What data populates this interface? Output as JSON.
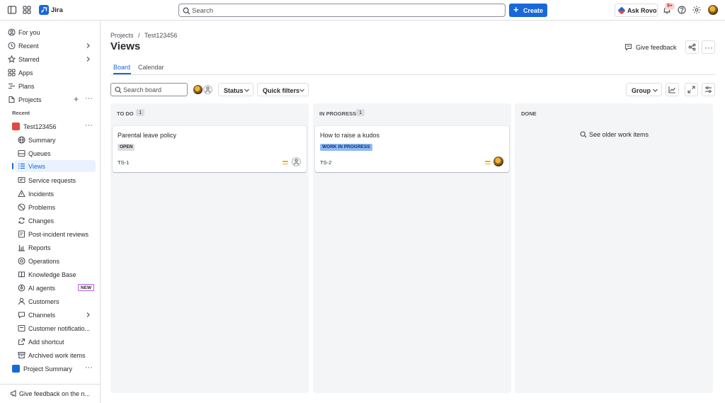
{
  "topbar": {
    "app_name": "Jira",
    "search_placeholder": "Search",
    "create_label": "Create",
    "ask_rovo_label": "Ask Rovo",
    "notifications_badge": "9+"
  },
  "sidebar": {
    "top_items": [
      {
        "label": "For you",
        "icon": "person-circle-icon"
      },
      {
        "label": "Recent",
        "icon": "clock-icon"
      },
      {
        "label": "Starred",
        "icon": "star-icon"
      },
      {
        "label": "Apps",
        "icon": "apps-grid-icon"
      },
      {
        "label": "Plans",
        "icon": "plans-icon"
      },
      {
        "label": "Projects",
        "icon": "projects-icon"
      }
    ],
    "recent_header": "Recent",
    "project": {
      "name": "Test123456",
      "icon_color": "#E2483D"
    },
    "project_items": [
      {
        "label": "Summary",
        "icon": "globe-icon"
      },
      {
        "label": "Queues",
        "icon": "queues-icon"
      },
      {
        "label": "Views",
        "icon": "list-icon"
      },
      {
        "label": "Service requests",
        "icon": "service-request-icon"
      },
      {
        "label": "Incidents",
        "icon": "warning-icon"
      },
      {
        "label": "Problems",
        "icon": "problem-icon"
      },
      {
        "label": "Changes",
        "icon": "changes-icon"
      },
      {
        "label": "Post-incident reviews",
        "icon": "review-icon"
      },
      {
        "label": "Reports",
        "icon": "chart-icon"
      },
      {
        "label": "Operations",
        "icon": "operations-icon"
      },
      {
        "label": "Knowledge Base",
        "icon": "book-icon"
      },
      {
        "label": "AI agents",
        "icon": "ai-agent-icon"
      },
      {
        "label": "Customers",
        "icon": "customers-icon"
      },
      {
        "label": "Channels",
        "icon": "channels-icon"
      },
      {
        "label": "Customer notificatio...",
        "icon": "notification-icon"
      },
      {
        "label": "Add shortcut",
        "icon": "shortcut-icon"
      },
      {
        "label": "Archived work items",
        "icon": "archive-icon"
      }
    ],
    "new_lozenge": "NEW",
    "project2": {
      "name": "Project Summary",
      "icon_color": "#1868DB"
    },
    "bottom_feedback": "Give feedback on the n..."
  },
  "main": {
    "breadcrumbs": [
      "Projects",
      "/",
      "Test123456"
    ],
    "title": "Views",
    "give_feedback_label": "Give feedback",
    "tabs": [
      "Board",
      "Calendar"
    ],
    "toolbar": {
      "search_placeholder": "Search board",
      "status_label": "Status",
      "quick_filters_label": "Quick filters",
      "group_label": "Group"
    },
    "columns": [
      {
        "title": "TO DO",
        "count": "1",
        "card": {
          "summary": "Parental leave policy",
          "status": "OPEN",
          "key": "TS-1",
          "assignee": "unassigned",
          "status_bg": "#DDDEE1",
          "status_fg": "#292A2E"
        }
      },
      {
        "title": "IN PROGRESS",
        "count": "1",
        "card": {
          "summary": "How to raise a kudos",
          "status": "WORK IN PROGRESS",
          "key": "TS-2",
          "assignee": "user",
          "status_bg": "#8FB8F6",
          "status_fg": "#09326C"
        }
      },
      {
        "title": "DONE",
        "see_older_label": "See older work items"
      }
    ]
  },
  "colors": {
    "brand": "#1868DB",
    "priority_medium": "#E2B203"
  }
}
